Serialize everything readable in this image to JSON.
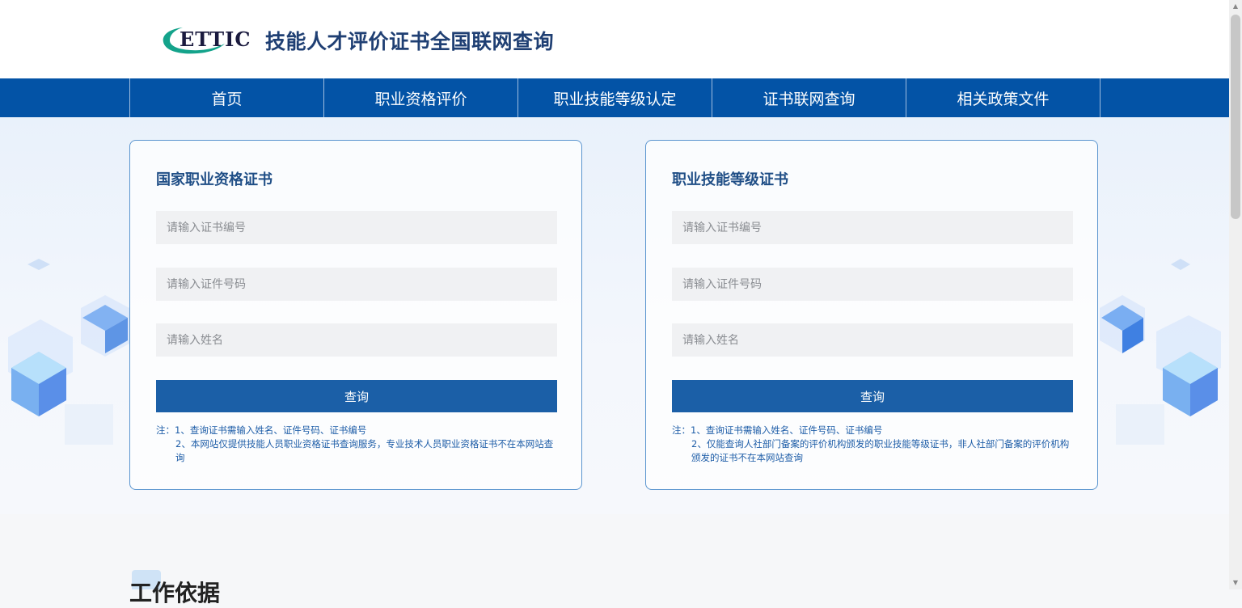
{
  "header": {
    "logo_text": "ETTIC",
    "site_title": "技能人才评价证书全国联网查询"
  },
  "nav": {
    "items": [
      {
        "label": "首页"
      },
      {
        "label": "职业资格评价"
      },
      {
        "label": "职业技能等级认定"
      },
      {
        "label": "证书联网查询"
      },
      {
        "label": "相关政策文件"
      }
    ]
  },
  "cards": [
    {
      "title": "国家职业资格证书",
      "cert_no_placeholder": "请输入证书编号",
      "id_no_placeholder": "请输入证件号码",
      "name_placeholder": "请输入姓名",
      "button_label": "查询",
      "note_1": "注：1、查询证书需输入姓名、证件号码、证书编号",
      "note_2": "2、本网站仅提供技能人员职业资格证书查询服务，专业技术人员职业资格证书不在本网站查询"
    },
    {
      "title": "职业技能等级证书",
      "cert_no_placeholder": "请输入证书编号",
      "id_no_placeholder": "请输入证件号码",
      "name_placeholder": "请输入姓名",
      "button_label": "查询",
      "note_1": "注：1、查询证书需输入姓名、证件号码、证书编号",
      "note_2": "2、仅能查询人社部门备案的评价机构颁发的职业技能等级证书，非人社部门备案的评价机构颁发的证书不在本网站查询"
    }
  ],
  "section": {
    "title": "工作依据"
  },
  "colors": {
    "nav_bg": "#0353a6",
    "button_bg": "#1b5fa7",
    "card_border": "#5a95cf",
    "note_text": "#1f5ea8"
  }
}
